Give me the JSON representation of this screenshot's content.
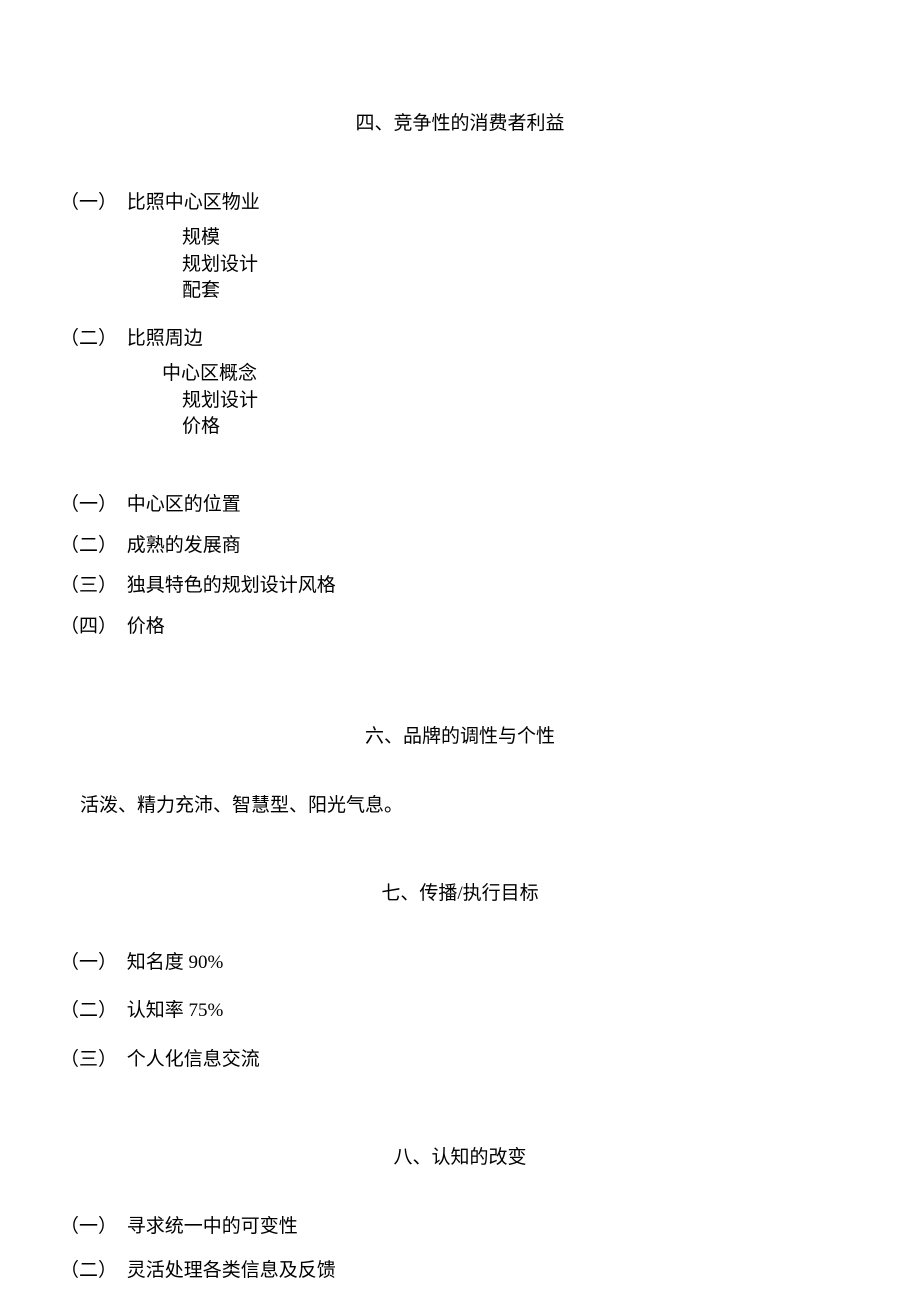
{
  "sections": {
    "s4": {
      "title": "四、竞争性的消费者利益",
      "groupA": {
        "marker": "（一）",
        "label": "比照中心区物业",
        "subs": [
          "规模",
          "规划设计",
          "配套"
        ]
      },
      "groupB": {
        "marker": "（二）",
        "label": "比照周边",
        "first": "中心区概念",
        "subs": [
          "规划设计",
          "价格"
        ]
      },
      "list": [
        {
          "marker": "（一）",
          "text": "中心区的位置"
        },
        {
          "marker": "（二）",
          "text": "成熟的发展商"
        },
        {
          "marker": "（三）",
          "text": "独具特色的规划设计风格"
        },
        {
          "marker": "（四）",
          "text": "价格"
        }
      ]
    },
    "s6": {
      "title": "六、品牌的调性与个性",
      "body": "活泼、精力充沛、智慧型、阳光气息。"
    },
    "s7": {
      "title": "七、传播/执行目标",
      "list": [
        {
          "marker": "（一）",
          "text": "知名度 90%"
        },
        {
          "marker": "（二）",
          "text": "认知率 75%"
        },
        {
          "marker": "（三）",
          "text": "个人化信息交流"
        }
      ]
    },
    "s8": {
      "title": "八、认知的改变",
      "list": [
        {
          "marker": "（一）",
          "text": "寻求统一中的可变性"
        },
        {
          "marker": "（二）",
          "text": "灵活处理各类信息及反馈"
        }
      ]
    }
  }
}
